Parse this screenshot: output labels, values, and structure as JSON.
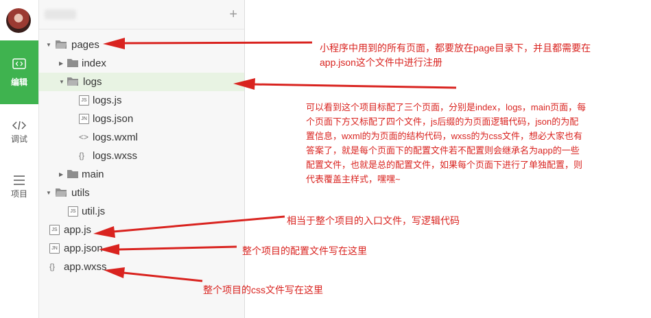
{
  "activity_bar": {
    "items": [
      {
        "label": "编辑",
        "icon": "code-icon",
        "active": true
      },
      {
        "label": "调试",
        "icon": "debug-icon",
        "active": false
      },
      {
        "label": "项目",
        "icon": "menu-icon",
        "active": false
      }
    ]
  },
  "tree": {
    "add_icon": "plus-icon",
    "items": [
      {
        "name": "pages",
        "type": "folder",
        "expanded": true
      },
      {
        "name": "index",
        "type": "folder",
        "expanded": false
      },
      {
        "name": "logs",
        "type": "folder",
        "expanded": true,
        "selected": true
      },
      {
        "name": "logs.js",
        "type": "js",
        "badge": "JS"
      },
      {
        "name": "logs.json",
        "type": "json",
        "badge": "JN"
      },
      {
        "name": "logs.wxml",
        "type": "wxml",
        "badge": "<>"
      },
      {
        "name": "logs.wxss",
        "type": "wxss",
        "badge": "{}"
      },
      {
        "name": "main",
        "type": "folder",
        "expanded": false
      },
      {
        "name": "utils",
        "type": "folder",
        "expanded": true
      },
      {
        "name": "util.js",
        "type": "js",
        "badge": "JS"
      },
      {
        "name": "app.js",
        "type": "js",
        "badge": "JS"
      },
      {
        "name": "app.json",
        "type": "json",
        "badge": "JN"
      },
      {
        "name": "app.wxss",
        "type": "wxss",
        "badge": "{}"
      }
    ]
  },
  "annotations": [
    {
      "lines": [
        "小程序中用到的所有页面，都要放在page目录下，并且都需要在",
        "app.json这个文件中进行注册"
      ]
    },
    {
      "lines": [
        "可以看到这个项目标配了三个页面，分别是index，logs，main页面，每",
        "个页面下方又标配了四个文件，js后缀的为页面逻辑代码，json的为配",
        "置信息，wxml的为页面的结构代码，wxss的为css文件，想必大家也有",
        "答案了，就是每个页面下的配置文件若不配置则会继承名为app的一些",
        "配置文件，也就是总的配置文件，如果每个页面下进行了单独配置，则",
        "代表覆盖主样式，嘿嘿~"
      ]
    },
    {
      "lines": [
        "相当于整个项目的入口文件，写逻辑代码"
      ]
    },
    {
      "lines": [
        "整个项目的配置文件写在这里"
      ]
    },
    {
      "lines": [
        "整个项目的css文件写在这里"
      ]
    }
  ],
  "colors": {
    "accent": "#3fb34f",
    "annotation": "#d9231f",
    "selected_row": "#e8f3e3"
  }
}
